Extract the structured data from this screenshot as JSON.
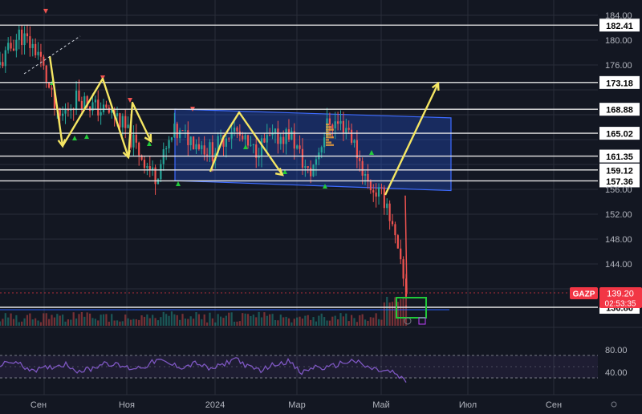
{
  "chart_data": {
    "type": "line",
    "symbol": "GAZP",
    "y_axis": {
      "range": [
        136,
        185
      ],
      "ticks": [
        184.0,
        180.0,
        176.0,
        172.0,
        168.0,
        164.0,
        160.0,
        156.0,
        152.0,
        148.0,
        144.0,
        140.0
      ],
      "tick_labels": [
        "184.00",
        "180.00",
        "176.00",
        "",
        "",
        "",
        "",
        "156.00",
        "152.00",
        "148.00",
        "144.00",
        ""
      ]
    },
    "x_axis": {
      "labels": [
        "Сен",
        "Ноя",
        "2024",
        "Мар",
        "Май",
        "Июл",
        "Сен"
      ]
    },
    "horizontal_levels": [
      {
        "value": 182.41,
        "label": "182.41"
      },
      {
        "value": 173.18,
        "label": "173.18"
      },
      {
        "value": 168.88,
        "label": "168.88"
      },
      {
        "value": 165.02,
        "label": "165.02"
      },
      {
        "value": 161.35,
        "label": "161.35"
      },
      {
        "value": 159.12,
        "label": "159.12"
      },
      {
        "value": 157.36,
        "label": "157.36"
      },
      {
        "value": 136.86,
        "label": "136.86"
      }
    ],
    "current_price": {
      "label": "GAZP",
      "value": "139.20",
      "countdown": "02:53:35"
    },
    "price_series": {
      "dates": [
        "2023-08",
        "2023-08-15",
        "2023-09",
        "2023-09-15",
        "2023-10",
        "2023-10-15",
        "2023-11",
        "2023-11-15",
        "2023-12",
        "2023-12-15",
        "2024-01",
        "2024-01-15",
        "2024-02",
        "2024-02-15",
        "2024-03",
        "2024-03-15",
        "2024-04",
        "2024-04-15",
        "2024-05",
        "2024-05-10",
        "2024-05-15",
        "2024-05-20"
      ],
      "values": [
        176,
        181,
        178,
        167,
        171,
        169,
        168,
        163,
        158,
        165,
        164,
        162,
        166,
        162,
        164,
        165,
        158,
        167,
        166,
        157,
        154,
        139.2
      ]
    },
    "channel": {
      "top": [
        168.9,
        167.5
      ],
      "bottom": [
        157.4,
        155.8
      ]
    },
    "annotations": [
      {
        "type": "zigzag_arrows",
        "color": "#f5e663"
      },
      {
        "type": "projection_arrow",
        "target": 173.18,
        "color": "#f5e663"
      },
      {
        "type": "target_box",
        "around": 136.86,
        "color": "#21c93a"
      }
    ],
    "rsi": {
      "ticks": [
        80.0,
        40.0
      ],
      "tick_labels": [
        "80.00",
        "40.00"
      ],
      "range": [
        20,
        90
      ],
      "upper_band": 70,
      "lower_band": 30,
      "values": [
        52,
        60,
        48,
        44,
        50,
        55,
        42,
        46,
        58,
        52,
        47,
        50,
        62,
        54,
        49,
        57,
        45,
        53,
        66,
        48,
        44,
        55,
        60,
        38,
        50,
        47,
        56,
        61,
        49,
        43,
        40,
        22
      ]
    },
    "colors": {
      "background": "#131722",
      "grid": "#2a2e39",
      "level_line": "#e6e6e6",
      "channel_fill": "#2962ff",
      "candle_up": "#26a69a",
      "candle_down": "#ef5350",
      "annotation": "#f5e663",
      "rsi_line": "#7e57c2",
      "price_badge": "#f23645"
    }
  }
}
